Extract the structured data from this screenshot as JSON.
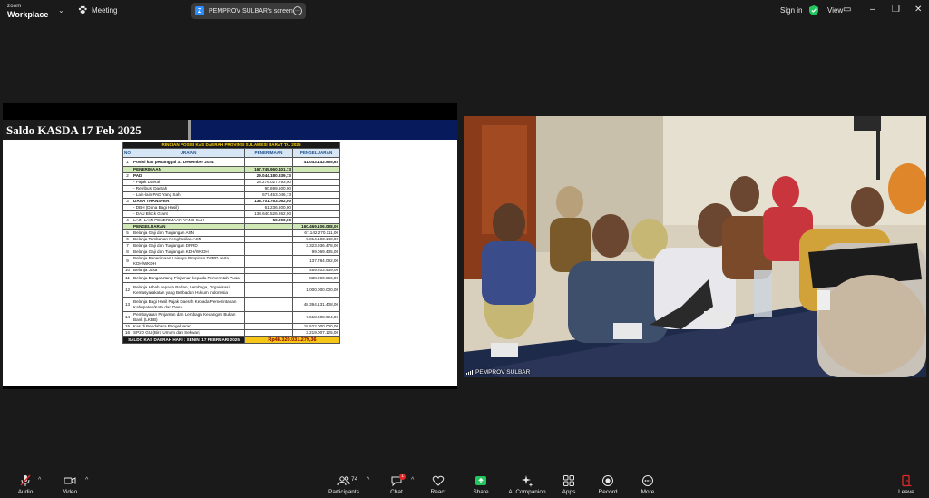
{
  "app": {
    "brand_top": "zoom",
    "brand_bottom": "Workplace",
    "meeting_label": "Meeting"
  },
  "share_pill": {
    "text": "PEMPROV SULBAR's screen"
  },
  "top_right": {
    "signin": "Sign in",
    "view": "View"
  },
  "slide": {
    "title": "Saldo KASDA 17 Feb 2025",
    "table_title": "RINCIAN POSISI KAS DAERAH PROVINSI SULAWESI BARAT TA. 2025",
    "columns": [
      "NO",
      "URAIAN",
      "PENERIMAAN",
      "PENGELUARAN"
    ],
    "rows": [
      {
        "no": "1",
        "desc": "Posisi kas pertanggal 31 Desember 2024",
        "in": "",
        "out": "41.043.143.965,63"
      },
      {
        "no": "",
        "desc": "PENERIMAAN",
        "in": "167.745.960.401,73",
        "out": ""
      },
      {
        "no": "2",
        "desc": "PAD",
        "in": "29.044.180.339,73",
        "out": ""
      },
      {
        "no": "",
        "desc": "- Pajak Daerah",
        "in": "28.276.027.793,00",
        "out": ""
      },
      {
        "no": "",
        "desc": "- Retribusi  Daerah",
        "in": "90.699.500,00",
        "out": ""
      },
      {
        "no": "",
        "desc": "- Lain-lain PAD Yang Sah",
        "in": "677.453.046,73",
        "out": ""
      },
      {
        "no": "3",
        "desc": "DANA TRANSFER",
        "in": "138.701.763.062,00",
        "out": ""
      },
      {
        "no": "",
        "desc": "- DBH (Dana Bagi Hasil)",
        "in": "61.236.800,00",
        "out": ""
      },
      {
        "no": "",
        "desc": "- DAU Block Grant",
        "in": "138.640.526.262,00",
        "out": ""
      },
      {
        "no": "4",
        "desc": "LAIN-LAIN PENERIMAAN YANG SAH",
        "in": "50.000,00",
        "out": ""
      },
      {
        "no": "",
        "desc": "PENGELUARAN",
        "in": "",
        "out": "160.469.106.088,00"
      },
      {
        "no": "5",
        "desc": "Belanja Gaji dan Tunjangan ASN",
        "in": "",
        "out": "67.142.270.111,00"
      },
      {
        "no": "6",
        "desc": "Belanja Tambahan Penghasilan ASN",
        "in": "",
        "out": "9.814.103.140,00"
      },
      {
        "no": "7",
        "desc": "Belanja Gaji dan Tunjangan DPRD",
        "in": "",
        "out": "3.323.936.478,00"
      },
      {
        "no": "8",
        "desc": "Belanja Gaji dan Tunjangan KDH/WKDH",
        "in": "",
        "out": "99.069.435,00"
      },
      {
        "no": "9",
        "desc": "Belanja Penerimaan Lainnya Pimpinan DPRD serta KDH/WKDH",
        "in": "",
        "out": "137.784.092,00"
      },
      {
        "no": "10",
        "desc": "Belanja Jasa",
        "in": "",
        "out": "459.203.439,00"
      },
      {
        "no": "11",
        "desc": "Belanja Bunga Utang Pinjaman kepada Pemerintah Pusat",
        "in": "",
        "out": "838.990.866,00"
      },
      {
        "no": "12",
        "desc": "Belanja Hibah kepada Badan, Lembaga, Organisasi Kemasyarakatan yang Berbadan Hukum Indonesia",
        "in": "",
        "out": "1.000.000.000,00"
      },
      {
        "no": "13",
        "desc": "Belanja Bagi Hasil Pajak Daerah Kepada Pemerintahan Kabupaten/Kota dan Desa",
        "in": "",
        "out": "48.394.131.408,00"
      },
      {
        "no": "14",
        "desc": "Pembayaran Pinjaman dan Lembaga Keuangan Bukan Bank (LKBB)",
        "in": "",
        "out": "7.518.608.994,00"
      },
      {
        "no": "15",
        "desc": "Kas di Bendahara Pengeluaran",
        "in": "",
        "out": "18.522.000.000,00"
      },
      {
        "no": "16",
        "desc": "SP2D GU (Biro Umum dan Sekwan)",
        "in": "",
        "out": "3.219.007.125,00"
      }
    ],
    "total_label": "SALDO KAS DAERAH HARI : SENIN, 17 FEBRUARI 2025",
    "total_value": "Rp48.320.031.279,36"
  },
  "video": {
    "participant_name": "PEMPROV SULBAR"
  },
  "toolbar": {
    "audio": "Audio",
    "video": "Video",
    "participants": "Participants",
    "participants_count": "74",
    "chat": "Chat",
    "chat_badge": "1",
    "react": "React",
    "share": "Share",
    "ai_companion": "AI Companion",
    "apps": "Apps",
    "record": "Record",
    "more": "More",
    "leave": "Leave"
  },
  "colors": {
    "share_green": "#22c55e",
    "leave_red": "#e02828",
    "slide_header_navy": "#061a5c",
    "total_yellow": "#f5c518"
  }
}
